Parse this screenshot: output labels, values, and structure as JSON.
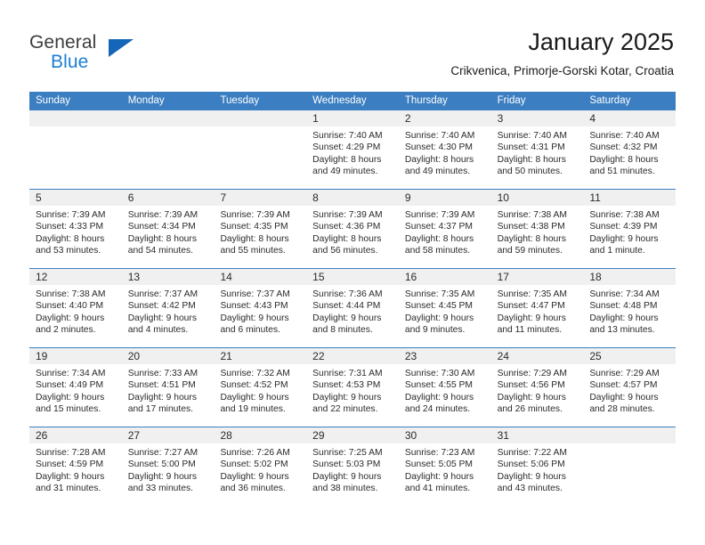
{
  "brand": {
    "name_part1": "General",
    "name_part2": "Blue",
    "logo_icon": "triangle-flag-icon"
  },
  "header": {
    "title": "January 2025",
    "subtitle": "Crikvenica, Primorje-Gorski Kotar, Croatia"
  },
  "colors": {
    "header_blue": "#3b7ec1",
    "brand_blue": "#1a7fd4",
    "day_band_gray": "#f0f0f0"
  },
  "calendar": {
    "day_names": [
      "Sunday",
      "Monday",
      "Tuesday",
      "Wednesday",
      "Thursday",
      "Friday",
      "Saturday"
    ],
    "weeks": [
      [
        {
          "day": "",
          "lines": []
        },
        {
          "day": "",
          "lines": []
        },
        {
          "day": "",
          "lines": []
        },
        {
          "day": "1",
          "lines": [
            "Sunrise: 7:40 AM",
            "Sunset: 4:29 PM",
            "Daylight: 8 hours",
            "and 49 minutes."
          ]
        },
        {
          "day": "2",
          "lines": [
            "Sunrise: 7:40 AM",
            "Sunset: 4:30 PM",
            "Daylight: 8 hours",
            "and 49 minutes."
          ]
        },
        {
          "day": "3",
          "lines": [
            "Sunrise: 7:40 AM",
            "Sunset: 4:31 PM",
            "Daylight: 8 hours",
            "and 50 minutes."
          ]
        },
        {
          "day": "4",
          "lines": [
            "Sunrise: 7:40 AM",
            "Sunset: 4:32 PM",
            "Daylight: 8 hours",
            "and 51 minutes."
          ]
        }
      ],
      [
        {
          "day": "5",
          "lines": [
            "Sunrise: 7:39 AM",
            "Sunset: 4:33 PM",
            "Daylight: 8 hours",
            "and 53 minutes."
          ]
        },
        {
          "day": "6",
          "lines": [
            "Sunrise: 7:39 AM",
            "Sunset: 4:34 PM",
            "Daylight: 8 hours",
            "and 54 minutes."
          ]
        },
        {
          "day": "7",
          "lines": [
            "Sunrise: 7:39 AM",
            "Sunset: 4:35 PM",
            "Daylight: 8 hours",
            "and 55 minutes."
          ]
        },
        {
          "day": "8",
          "lines": [
            "Sunrise: 7:39 AM",
            "Sunset: 4:36 PM",
            "Daylight: 8 hours",
            "and 56 minutes."
          ]
        },
        {
          "day": "9",
          "lines": [
            "Sunrise: 7:39 AM",
            "Sunset: 4:37 PM",
            "Daylight: 8 hours",
            "and 58 minutes."
          ]
        },
        {
          "day": "10",
          "lines": [
            "Sunrise: 7:38 AM",
            "Sunset: 4:38 PM",
            "Daylight: 8 hours",
            "and 59 minutes."
          ]
        },
        {
          "day": "11",
          "lines": [
            "Sunrise: 7:38 AM",
            "Sunset: 4:39 PM",
            "Daylight: 9 hours",
            "and 1 minute."
          ]
        }
      ],
      [
        {
          "day": "12",
          "lines": [
            "Sunrise: 7:38 AM",
            "Sunset: 4:40 PM",
            "Daylight: 9 hours",
            "and 2 minutes."
          ]
        },
        {
          "day": "13",
          "lines": [
            "Sunrise: 7:37 AM",
            "Sunset: 4:42 PM",
            "Daylight: 9 hours",
            "and 4 minutes."
          ]
        },
        {
          "day": "14",
          "lines": [
            "Sunrise: 7:37 AM",
            "Sunset: 4:43 PM",
            "Daylight: 9 hours",
            "and 6 minutes."
          ]
        },
        {
          "day": "15",
          "lines": [
            "Sunrise: 7:36 AM",
            "Sunset: 4:44 PM",
            "Daylight: 9 hours",
            "and 8 minutes."
          ]
        },
        {
          "day": "16",
          "lines": [
            "Sunrise: 7:35 AM",
            "Sunset: 4:45 PM",
            "Daylight: 9 hours",
            "and 9 minutes."
          ]
        },
        {
          "day": "17",
          "lines": [
            "Sunrise: 7:35 AM",
            "Sunset: 4:47 PM",
            "Daylight: 9 hours",
            "and 11 minutes."
          ]
        },
        {
          "day": "18",
          "lines": [
            "Sunrise: 7:34 AM",
            "Sunset: 4:48 PM",
            "Daylight: 9 hours",
            "and 13 minutes."
          ]
        }
      ],
      [
        {
          "day": "19",
          "lines": [
            "Sunrise: 7:34 AM",
            "Sunset: 4:49 PM",
            "Daylight: 9 hours",
            "and 15 minutes."
          ]
        },
        {
          "day": "20",
          "lines": [
            "Sunrise: 7:33 AM",
            "Sunset: 4:51 PM",
            "Daylight: 9 hours",
            "and 17 minutes."
          ]
        },
        {
          "day": "21",
          "lines": [
            "Sunrise: 7:32 AM",
            "Sunset: 4:52 PM",
            "Daylight: 9 hours",
            "and 19 minutes."
          ]
        },
        {
          "day": "22",
          "lines": [
            "Sunrise: 7:31 AM",
            "Sunset: 4:53 PM",
            "Daylight: 9 hours",
            "and 22 minutes."
          ]
        },
        {
          "day": "23",
          "lines": [
            "Sunrise: 7:30 AM",
            "Sunset: 4:55 PM",
            "Daylight: 9 hours",
            "and 24 minutes."
          ]
        },
        {
          "day": "24",
          "lines": [
            "Sunrise: 7:29 AM",
            "Sunset: 4:56 PM",
            "Daylight: 9 hours",
            "and 26 minutes."
          ]
        },
        {
          "day": "25",
          "lines": [
            "Sunrise: 7:29 AM",
            "Sunset: 4:57 PM",
            "Daylight: 9 hours",
            "and 28 minutes."
          ]
        }
      ],
      [
        {
          "day": "26",
          "lines": [
            "Sunrise: 7:28 AM",
            "Sunset: 4:59 PM",
            "Daylight: 9 hours",
            "and 31 minutes."
          ]
        },
        {
          "day": "27",
          "lines": [
            "Sunrise: 7:27 AM",
            "Sunset: 5:00 PM",
            "Daylight: 9 hours",
            "and 33 minutes."
          ]
        },
        {
          "day": "28",
          "lines": [
            "Sunrise: 7:26 AM",
            "Sunset: 5:02 PM",
            "Daylight: 9 hours",
            "and 36 minutes."
          ]
        },
        {
          "day": "29",
          "lines": [
            "Sunrise: 7:25 AM",
            "Sunset: 5:03 PM",
            "Daylight: 9 hours",
            "and 38 minutes."
          ]
        },
        {
          "day": "30",
          "lines": [
            "Sunrise: 7:23 AM",
            "Sunset: 5:05 PM",
            "Daylight: 9 hours",
            "and 41 minutes."
          ]
        },
        {
          "day": "31",
          "lines": [
            "Sunrise: 7:22 AM",
            "Sunset: 5:06 PM",
            "Daylight: 9 hours",
            "and 43 minutes."
          ]
        },
        {
          "day": "",
          "lines": []
        }
      ]
    ]
  }
}
